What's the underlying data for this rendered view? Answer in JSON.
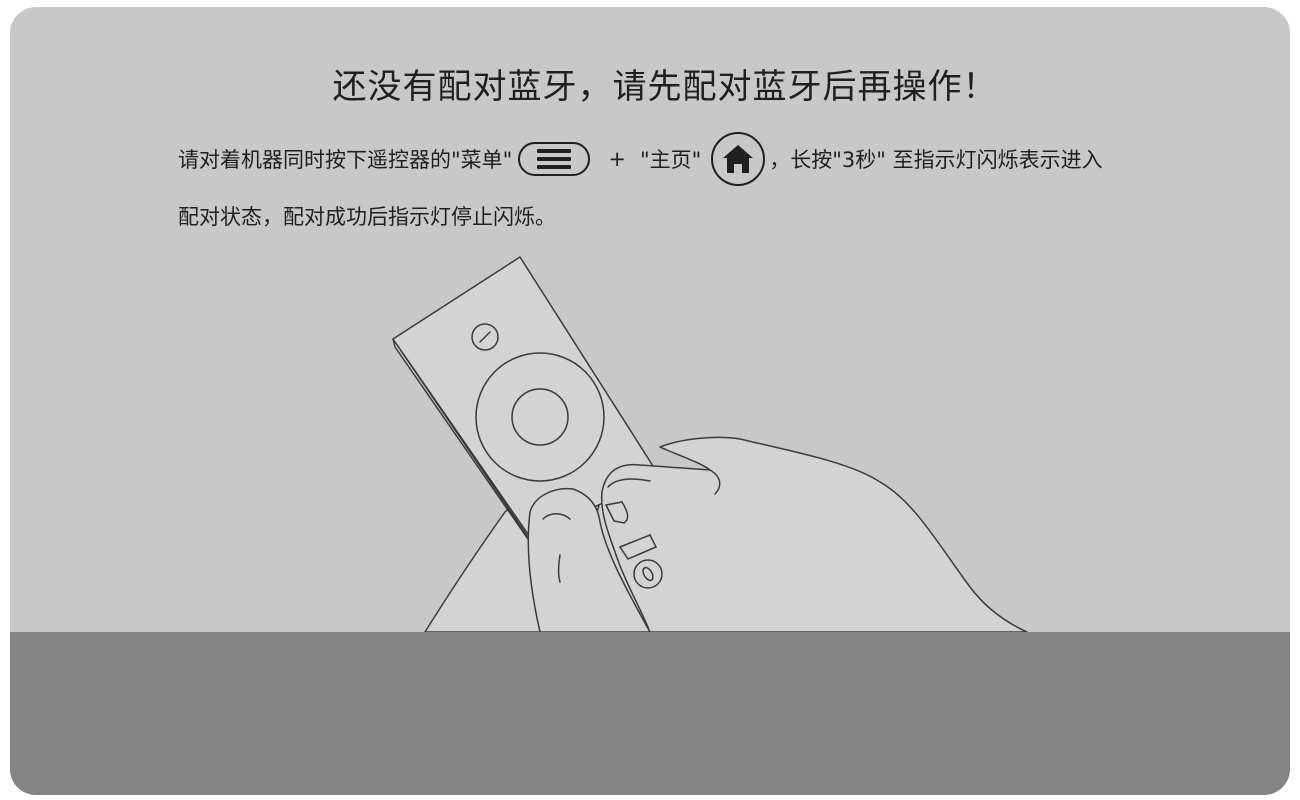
{
  "dialog": {
    "title": "还没有配对蓝牙，请先配对蓝牙后再操作！",
    "instruction": {
      "part1": "请对着机器同时按下遥控器的\"菜单\"",
      "plus": "+",
      "part2": "\"主页\"",
      "part3": "，长按\"3秒\" 至指示灯闪烁表示进入",
      "line2": "配对状态，配对成功后指示灯停止闪烁。"
    },
    "icons": {
      "menu": "menu-icon",
      "home": "home-icon",
      "power": "power-icon",
      "mic": "microphone-icon"
    },
    "colors": {
      "panel": "#c8c8c8",
      "bottom_bar": "#848484",
      "text": "#1f1f1f"
    }
  }
}
